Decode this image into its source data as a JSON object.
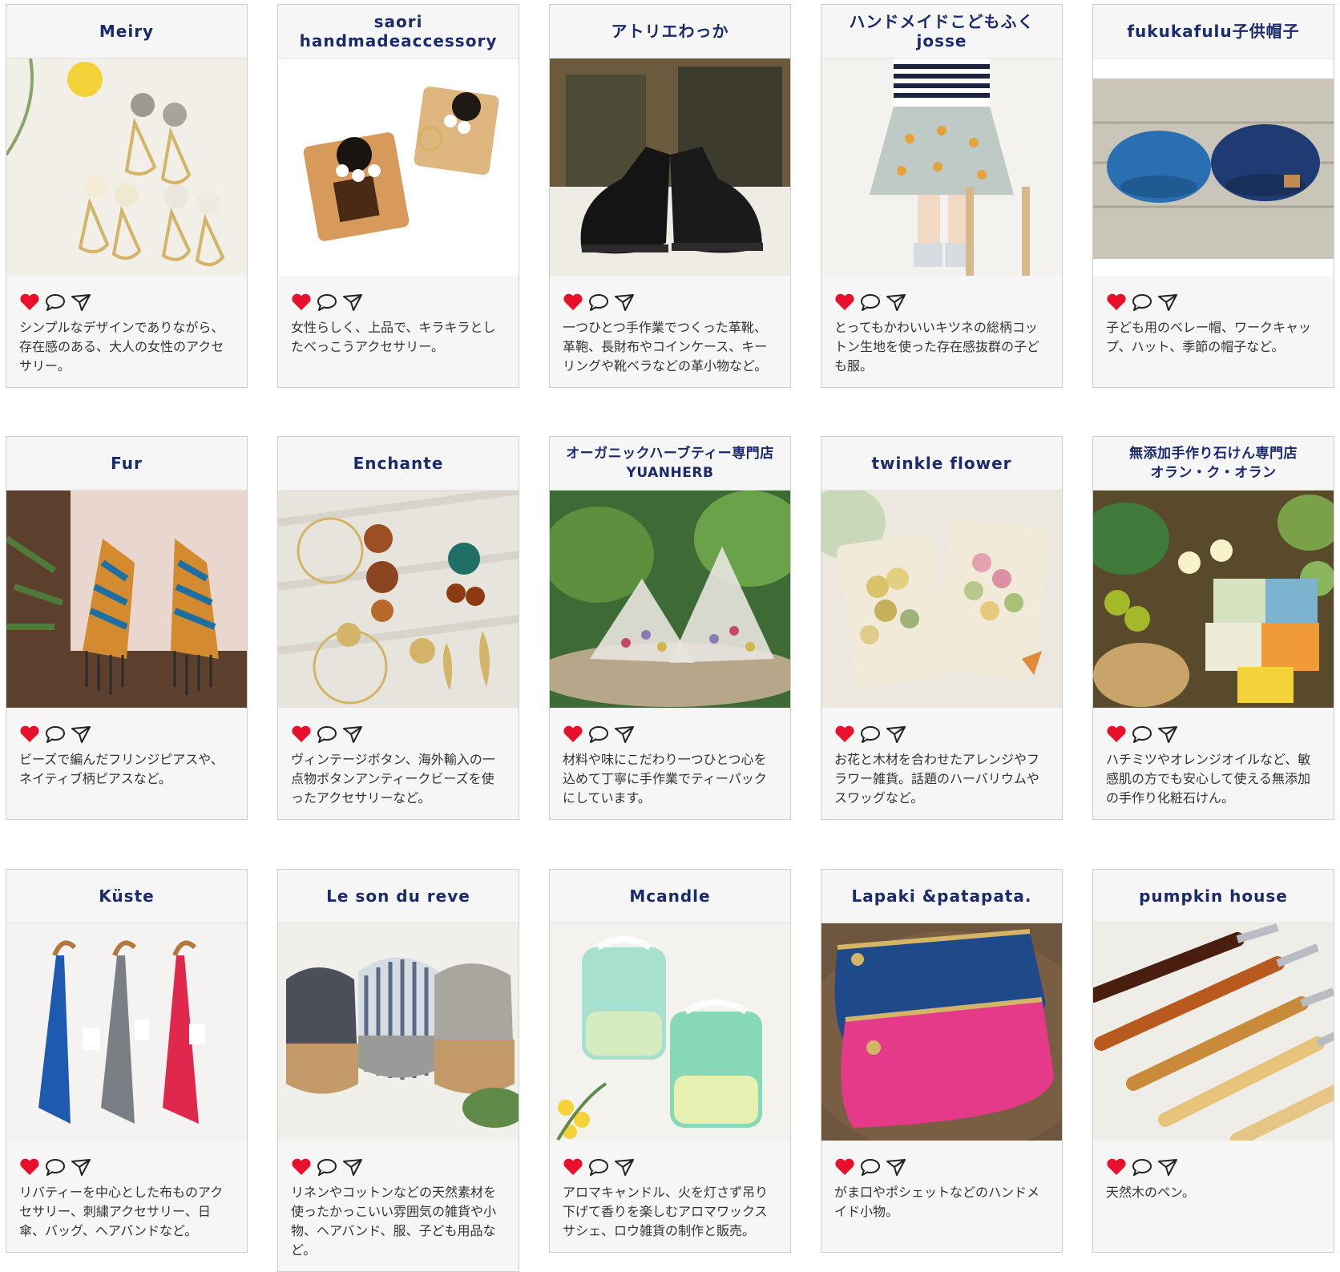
{
  "colors": {
    "title": "#1a2a6c",
    "heart": "#e8102a",
    "card_bg": "#f6f6f6",
    "border": "#cfcfcf"
  },
  "icons": [
    "heart-icon",
    "comment-icon",
    "share-icon"
  ],
  "shops": [
    {
      "name": "Meiry",
      "description": "シンプルなデザインでありながら、存在感のある、大人の女性のアクセサリー。"
    },
    {
      "name": "saori handmadeaccessory",
      "description": "女性らしく、上品で、キラキラとしたべっこうアクセサリー。"
    },
    {
      "name": "アトリエわっか",
      "description": "一つひとつ手作業でつくった革靴、革鞄、長財布やコインケース、キーリングや靴ベラなどの革小物など。"
    },
    {
      "name": "ハンドメイドこどもふくjosse",
      "description": "とってもかわいいキツネの総柄コットン生地を使った存在感抜群の子ども服。"
    },
    {
      "name": "fukukafulu子供帽子",
      "description": "子ども用のベレー帽、ワークキャップ、ハット、季節の帽子など。"
    },
    {
      "name": "Fur",
      "description": "ビーズで編んだフリンジピアスや、ネイティブ柄ピアスなど。"
    },
    {
      "name": "Enchante",
      "description": "ヴィンテージボタン、海外輸入の一点物ボタンアンティークビーズを使ったアクセサリーなど。"
    },
    {
      "name": "オーガニックハーブティー専門店\nYUANHERB",
      "description": "材料や味にこだわり一つひとつ心を込めて丁寧に手作業でティーパックにしています。"
    },
    {
      "name": "twinkle flower",
      "description": "お花と木材を合わせたアレンジやフラワー雑貨。話題のハーバリウムやスワッグなど。"
    },
    {
      "name": "無添加手作り石けん専門店\nオラン・ク・オラン",
      "description": "ハチミツやオレンジオイルなど、敏感肌の方でも安心して使える無添加の手作り化粧石けん。"
    },
    {
      "name": "Küste",
      "description": "リバティーを中心とした布ものアクセサリー、刺繍アクセサリー、日傘、バッグ、ヘアバンドなど。"
    },
    {
      "name": "Le son du reve",
      "description": "リネンやコットンなどの天然素材を使ったかっこいい雰囲気の雑貨や小物、ヘアバンド、服、子ども用品など。"
    },
    {
      "name": "Mcandle",
      "description": "アロマキャンドル、火を灯さず吊り下げて香りを楽しむアロマワックスサシェ、ロウ雑貨の制作と販売。"
    },
    {
      "name": "Lapaki &patapata.",
      "description": "がま口やポシェットなどのハンドメイド小物。"
    },
    {
      "name": "pumpkin house",
      "description": "天然木のペン。"
    }
  ]
}
